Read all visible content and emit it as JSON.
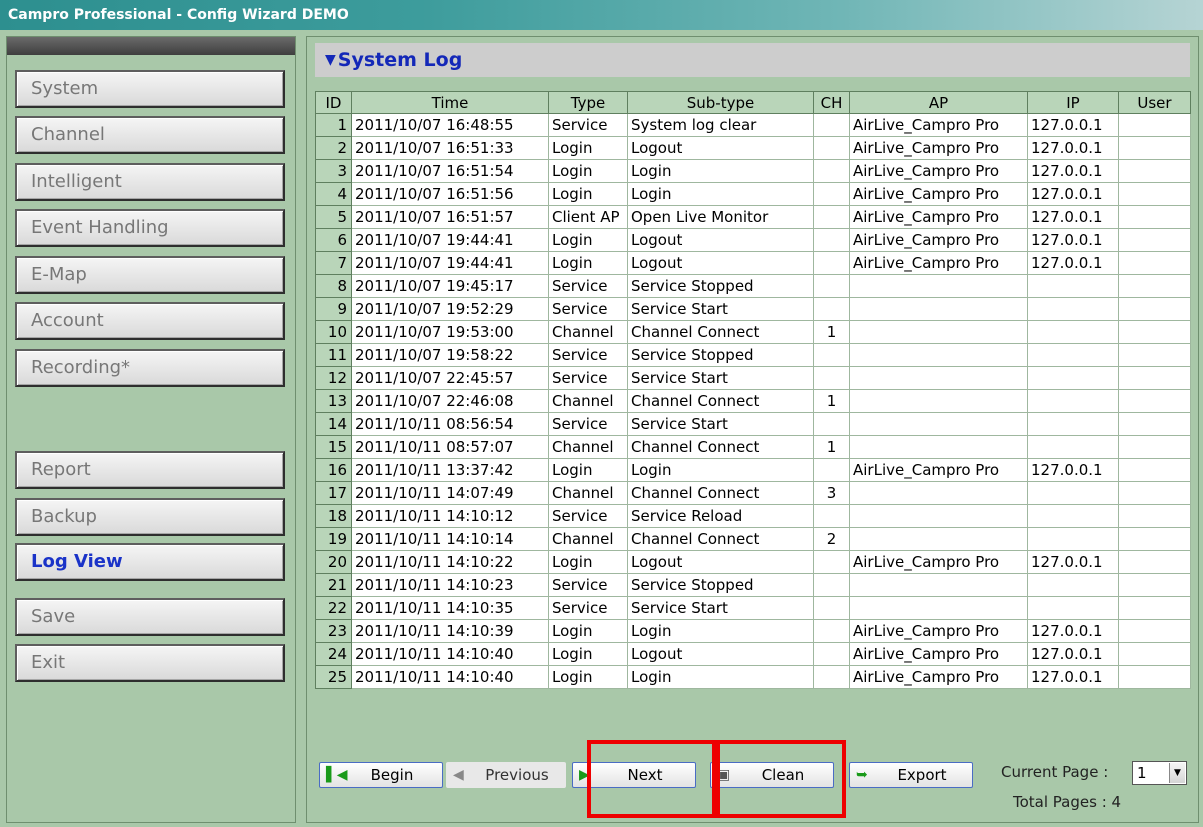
{
  "window": {
    "title": "Campro Professional - Config Wizard DEMO"
  },
  "sidebar": {
    "items": [
      {
        "label": "System",
        "active": false
      },
      {
        "label": "Channel",
        "active": false
      },
      {
        "label": "Intelligent",
        "active": false
      },
      {
        "label": "Event Handling",
        "active": false
      },
      {
        "label": "E-Map",
        "active": false
      },
      {
        "label": "Account",
        "active": false
      },
      {
        "label": "Recording*",
        "active": false
      },
      {
        "label": "Report",
        "active": false
      },
      {
        "label": "Backup",
        "active": false
      },
      {
        "label": "Log View",
        "active": true
      },
      {
        "label": "Save",
        "active": false
      },
      {
        "label": "Exit",
        "active": false
      }
    ]
  },
  "main": {
    "header": {
      "title": "System Log",
      "icon": "network-icon"
    },
    "columns": [
      "ID",
      "Time",
      "Type",
      "Sub-type",
      "CH",
      "AP",
      "IP",
      "User"
    ],
    "rows": [
      [
        "1",
        "2011/10/07 16:48:55",
        "Service",
        "System log clear",
        "",
        "AirLive_Campro Pro",
        "127.0.0.1",
        ""
      ],
      [
        "2",
        "2011/10/07 16:51:33",
        "Login",
        "Logout",
        "",
        "AirLive_Campro Pro",
        "127.0.0.1",
        ""
      ],
      [
        "3",
        "2011/10/07 16:51:54",
        "Login",
        "Login",
        "",
        "AirLive_Campro Pro",
        "127.0.0.1",
        ""
      ],
      [
        "4",
        "2011/10/07 16:51:56",
        "Login",
        "Login",
        "",
        "AirLive_Campro Pro",
        "127.0.0.1",
        ""
      ],
      [
        "5",
        "2011/10/07 16:51:57",
        "Client AP",
        "Open Live Monitor",
        "",
        "AirLive_Campro Pro",
        "127.0.0.1",
        ""
      ],
      [
        "6",
        "2011/10/07 19:44:41",
        "Login",
        "Logout",
        "",
        "AirLive_Campro Pro",
        "127.0.0.1",
        ""
      ],
      [
        "7",
        "2011/10/07 19:44:41",
        "Login",
        "Logout",
        "",
        "AirLive_Campro Pro",
        "127.0.0.1",
        ""
      ],
      [
        "8",
        "2011/10/07 19:45:17",
        "Service",
        "Service Stopped",
        "",
        "",
        "",
        ""
      ],
      [
        "9",
        "2011/10/07 19:52:29",
        "Service",
        "Service Start",
        "",
        "",
        "",
        ""
      ],
      [
        "10",
        "2011/10/07 19:53:00",
        "Channel",
        "Channel Connect",
        "1",
        "",
        "",
        ""
      ],
      [
        "11",
        "2011/10/07 19:58:22",
        "Service",
        "Service Stopped",
        "",
        "",
        "",
        ""
      ],
      [
        "12",
        "2011/10/07 22:45:57",
        "Service",
        "Service Start",
        "",
        "",
        "",
        ""
      ],
      [
        "13",
        "2011/10/07 22:46:08",
        "Channel",
        "Channel Connect",
        "1",
        "",
        "",
        ""
      ],
      [
        "14",
        "2011/10/11 08:56:54",
        "Service",
        "Service Start",
        "",
        "",
        "",
        ""
      ],
      [
        "15",
        "2011/10/11 08:57:07",
        "Channel",
        "Channel Connect",
        "1",
        "",
        "",
        ""
      ],
      [
        "16",
        "2011/10/11 13:37:42",
        "Login",
        "Login",
        "",
        "AirLive_Campro Pro",
        "127.0.0.1",
        ""
      ],
      [
        "17",
        "2011/10/11 14:07:49",
        "Channel",
        "Channel Connect",
        "3",
        "",
        "",
        ""
      ],
      [
        "18",
        "2011/10/11 14:10:12",
        "Service",
        "Service Reload",
        "",
        "",
        "",
        ""
      ],
      [
        "19",
        "2011/10/11 14:10:14",
        "Channel",
        "Channel Connect",
        "2",
        "",
        "",
        ""
      ],
      [
        "20",
        "2011/10/11 14:10:22",
        "Login",
        "Logout",
        "",
        "AirLive_Campro Pro",
        "127.0.0.1",
        ""
      ],
      [
        "21",
        "2011/10/11 14:10:23",
        "Service",
        "Service Stopped",
        "",
        "",
        "",
        ""
      ],
      [
        "22",
        "2011/10/11 14:10:35",
        "Service",
        "Service Start",
        "",
        "",
        "",
        ""
      ],
      [
        "23",
        "2011/10/11 14:10:39",
        "Login",
        "Login",
        "",
        "AirLive_Campro Pro",
        "127.0.0.1",
        ""
      ],
      [
        "24",
        "2011/10/11 14:10:40",
        "Login",
        "Logout",
        "",
        "AirLive_Campro Pro",
        "127.0.0.1",
        ""
      ],
      [
        "25",
        "2011/10/11 14:10:40",
        "Login",
        "Login",
        "",
        "AirLive_Campro Pro",
        "127.0.0.1",
        ""
      ]
    ],
    "pagination": {
      "begin_label": "Begin",
      "previous_label": "Previous",
      "next_label": "Next",
      "clean_label": "Clean",
      "export_label": "Export",
      "current_page_label": "Current Page :",
      "current_page_value": "1",
      "total_pages_label": "Total Pages : 4"
    }
  },
  "colors": {
    "accent_text": "#1a33c8",
    "background": "#a9c8a9",
    "highlight": "#ee0000"
  }
}
